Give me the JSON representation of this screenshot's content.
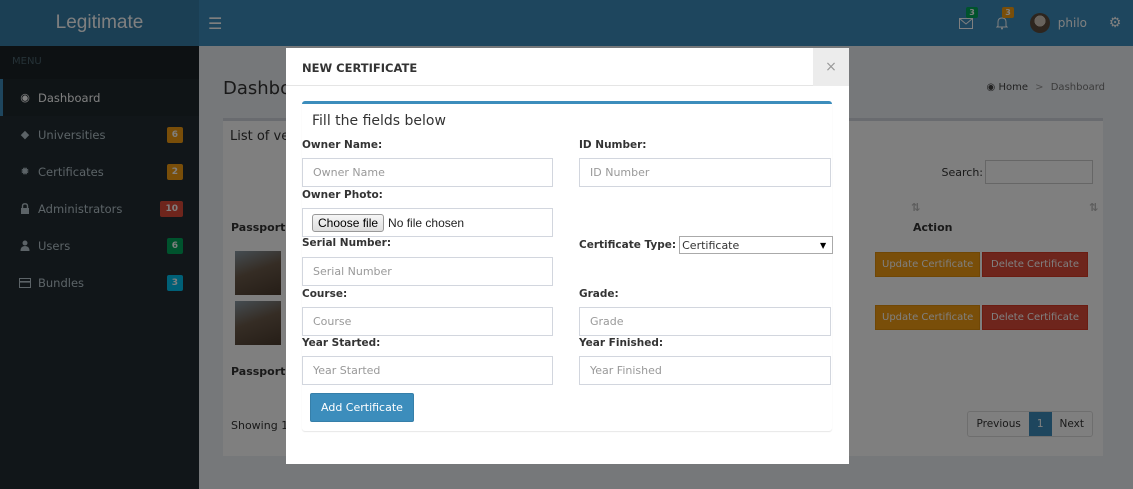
{
  "app": {
    "title": "Legitimate"
  },
  "header": {
    "messages_badge": "3",
    "notifications_badge": "3",
    "username": "philo",
    "colors": {
      "header": "#3c8dbc",
      "logo": "#367fa9"
    }
  },
  "sidebar": {
    "menu_header": "MENU",
    "items": [
      {
        "label": "Dashboard",
        "icon": "dashboard-icon",
        "badge": ""
      },
      {
        "label": "Universities",
        "icon": "graduation-cap-icon",
        "badge": "6",
        "badge_color": "#f39c12"
      },
      {
        "label": "Certificates",
        "icon": "certificate-icon",
        "badge": "2",
        "badge_color": "#f39c12"
      },
      {
        "label": "Administrators",
        "icon": "lock-icon",
        "badge": "10",
        "badge_color": "#dd4b39"
      },
      {
        "label": "Users",
        "icon": "user-icon",
        "badge": "6",
        "badge_color": "#00a65a"
      },
      {
        "label": "Bundles",
        "icon": "credit-card-icon",
        "badge": "3",
        "badge_color": "#00c0ef"
      }
    ]
  },
  "page": {
    "title": "Dashbo",
    "breadcrumb": {
      "home": "Home",
      "sep": ">",
      "current": "Dashboard"
    },
    "box_title": "List of ve",
    "search_label": "Search:",
    "columns": {
      "passport": "Passport",
      "action": "Action"
    },
    "sort_icon": "⇅",
    "rows": [
      {
        "update": "Update Certificate",
        "delete": "Delete Certificate"
      },
      {
        "update": "Update Certificate",
        "delete": "Delete Certificate"
      }
    ],
    "showing": "Showing 1",
    "pagination": {
      "previous": "Previous",
      "current": "1",
      "next": "Next"
    }
  },
  "modal": {
    "title": "NEW CERTIFICATE",
    "close": "×",
    "heading": "Fill the fields below",
    "owner_name": {
      "label": "Owner Name:",
      "placeholder": "Owner Name"
    },
    "id_number": {
      "label": "ID Number:",
      "placeholder": "ID Number"
    },
    "owner_photo": {
      "label": "Owner Photo:",
      "button": "Choose file",
      "status": "No file chosen"
    },
    "serial_number": {
      "label": "Serial Number:",
      "placeholder": "Serial Number"
    },
    "certificate_type": {
      "label": "Certificate Type:",
      "selected": "Certificate"
    },
    "course": {
      "label": "Course:",
      "placeholder": "Course"
    },
    "grade": {
      "label": "Grade:",
      "placeholder": "Grade"
    },
    "year_started": {
      "label": "Year Started:",
      "placeholder": "Year Started"
    },
    "year_finished": {
      "label": "Year Finished:",
      "placeholder": "Year Finished"
    },
    "submit": "Add Certificate"
  }
}
